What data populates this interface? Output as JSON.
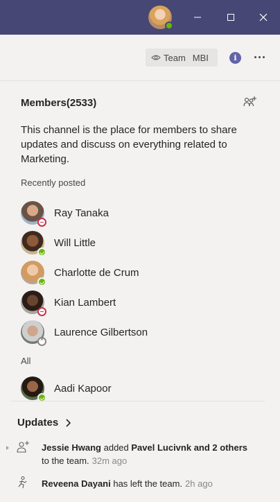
{
  "titlebar": {
    "user_presence": "available",
    "buttons": [
      "minimize",
      "maximize",
      "close"
    ]
  },
  "toolbar": {
    "team_label": "Team",
    "team_short": "MBI",
    "info_label": "i"
  },
  "members": {
    "title": "Members(2533)",
    "description": "This channel is the place for members to share updates and discuss on everything related to Marketing.",
    "recently_label": "Recently posted",
    "recent": [
      {
        "name": "Ray Tanaka",
        "presence": "dnd"
      },
      {
        "name": "Will Little",
        "presence": "available"
      },
      {
        "name": "Charlotte de Crum",
        "presence": "available"
      },
      {
        "name": "Kian Lambert",
        "presence": "dnd"
      },
      {
        "name": "Laurence Gilbertson",
        "presence": "offline"
      }
    ],
    "all_label": "All",
    "all": [
      {
        "name": "Aadi Kapoor",
        "presence": "available"
      }
    ]
  },
  "updates": {
    "title": "Updates",
    "items": [
      {
        "actor": "Jessie Hwang",
        "action": " added ",
        "target": "Pavel Lucivnk and 2 others",
        "suffix": " to the team.",
        "time": "32m ago",
        "icon": "add-person-icon"
      },
      {
        "actor": "Reveena Dayani",
        "action": " has left the team.",
        "time": "2h ago",
        "icon": "person-leave-icon"
      }
    ]
  },
  "colors": {
    "titlebar": "#464775",
    "accent": "#6264a7",
    "available": "#6bb700",
    "dnd": "#c4314b"
  }
}
